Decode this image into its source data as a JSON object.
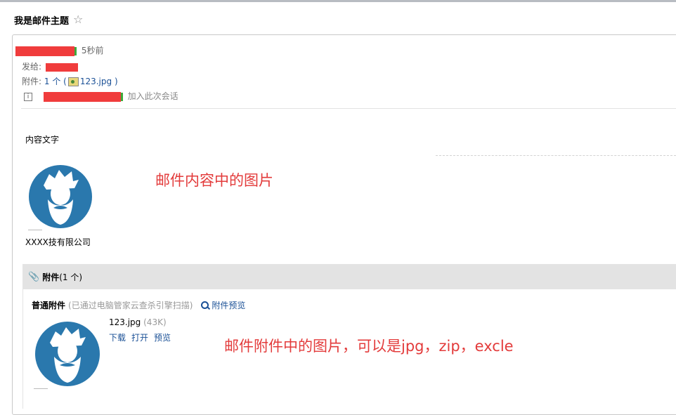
{
  "email": {
    "subject": "我是邮件主题",
    "time_ago": "5秒前",
    "to_label": "发给:",
    "attachments_label": "附件:",
    "attachments_count": "1 个 (",
    "attachments_file": "123.jpg",
    "attachments_close": ")",
    "join_conversation": "加入此次会话",
    "body_text": "内容文字",
    "company": "XXXX技有限公司"
  },
  "annotations": {
    "inline_image": "邮件内容中的图片",
    "attachment_image": "邮件附件中的图片，可以是jpg，zip，excle"
  },
  "attachment_section": {
    "title": "附件",
    "count": "(1 个)",
    "type_label": "普通附件",
    "scan_note": "(已通过电脑管家云查杀引擎扫描)",
    "preview_label": "附件预览",
    "file": {
      "name": "123.jpg",
      "size": "(43K)",
      "actions": [
        "下载",
        "打开",
        "预览"
      ]
    }
  },
  "icons": {
    "star": "star-icon",
    "paperclip": "paperclip-icon",
    "search": "search-icon",
    "info": "info-icon",
    "image": "image-file-icon"
  },
  "colors": {
    "accent_link": "#1a5096",
    "annotation_red": "#e33b3b",
    "avatar_blue": "#2a78ad"
  }
}
